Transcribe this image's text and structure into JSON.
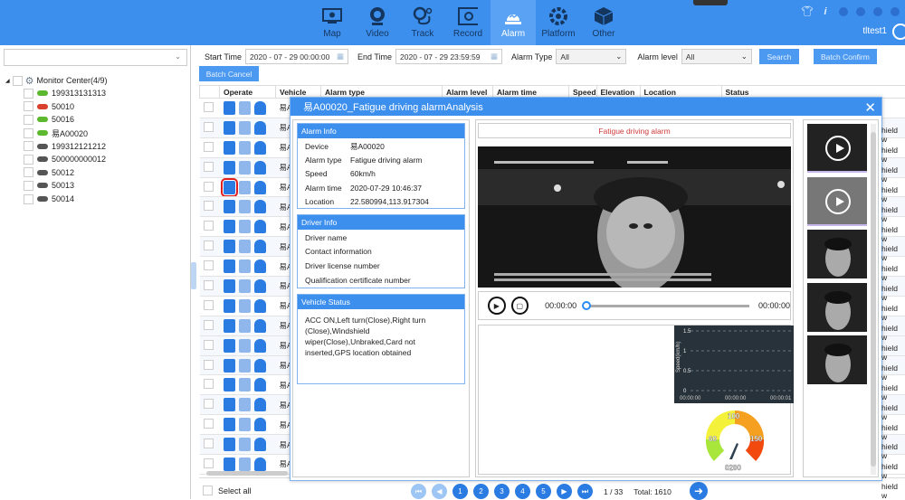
{
  "header": {
    "nav": [
      {
        "label": "Map",
        "icon": "monitor-eye-icon"
      },
      {
        "label": "Video",
        "icon": "webcam-icon"
      },
      {
        "label": "Track",
        "icon": "route-pin-icon"
      },
      {
        "label": "Record",
        "icon": "film-icon"
      },
      {
        "label": "Alarm",
        "icon": "alarm-light-icon",
        "active": true
      },
      {
        "label": "Platform",
        "icon": "gear-icon"
      },
      {
        "label": "Other",
        "icon": "cube-icon"
      }
    ],
    "username": "tltest1",
    "accent": "#3d8fee"
  },
  "sidebar": {
    "search_value": "",
    "root": "Monitor Center(4/9)",
    "vehicles": [
      {
        "id": "199313131313",
        "status": "online",
        "color": "#5cb82e"
      },
      {
        "id": "50010",
        "status": "alarm",
        "color": "#d9402b"
      },
      {
        "id": "50016",
        "status": "online",
        "color": "#5cb82e"
      },
      {
        "id": "易A00020",
        "status": "online",
        "color": "#5cb82e"
      },
      {
        "id": "199312121212",
        "status": "offline",
        "color": "#555555"
      },
      {
        "id": "500000000012",
        "status": "offline",
        "color": "#555555"
      },
      {
        "id": "50012",
        "status": "offline",
        "color": "#555555"
      },
      {
        "id": "50013",
        "status": "offline",
        "color": "#555555"
      },
      {
        "id": "50014",
        "status": "offline",
        "color": "#555555"
      }
    ]
  },
  "filters": {
    "start_label": "Start Time",
    "start_value": "2020 - 07 - 29 00:00:00",
    "end_label": "End Time",
    "end_value": "2020 - 07 - 29 23:59:59",
    "alarm_type_label": "Alarm Type",
    "alarm_type_value": "All",
    "alarm_level_label": "Alarm level",
    "alarm_level_value": "All",
    "search_btn": "Search",
    "batch_confirm_btn": "Batch Confirm",
    "batch_cancel_btn": "Batch Cancel"
  },
  "table": {
    "columns": [
      "",
      "Operate",
      "Vehicle",
      "Alarm type",
      "Alarm level",
      "Alarm time",
      "Speed",
      "Elevation",
      "Location",
      "Status"
    ],
    "row_vehicle": "易A",
    "row_status_tail": "hield w",
    "row_count": 19
  },
  "footer": {
    "select_all": "Select all",
    "pages": [
      "1",
      "2",
      "3",
      "4",
      "5"
    ],
    "page_info": "1  /  33",
    "total": "Total: 1610"
  },
  "modal": {
    "title": "易A00020_Fatigue driving alarmAnalysis",
    "alarm_info": {
      "title": "Alarm Info",
      "rows": [
        {
          "k": "Device",
          "v": "易A00020"
        },
        {
          "k": "Alarm type",
          "v": "Fatigue driving alarm"
        },
        {
          "k": "Speed",
          "v": "60km/h"
        },
        {
          "k": "Alarm time",
          "v": "2020-07-29 10:46:37"
        },
        {
          "k": "Location",
          "v": "22.580994,113.917304"
        }
      ]
    },
    "driver_info": {
      "title": "Driver Info",
      "rows": [
        "Driver name",
        "Contact information",
        "Driver license number",
        "Qualification certificate number"
      ]
    },
    "vehicle_status": {
      "title": "Vehicle Status",
      "text": "ACC ON,Left turn(Close),Right turn (Close),Windshield wiper(Close),Unbraked,Card not inserted,GPS location obtained"
    },
    "alarm_title": "Fatigue driving alarm",
    "player": {
      "current": "00:00:00",
      "duration": "00:00:00",
      "progress": 0
    },
    "speed_chart": {
      "ylabel": "Speed(km/h)",
      "yticks": [
        "1.5",
        "1",
        "0.5",
        "0"
      ],
      "xticks": [
        "00:00:00",
        "00:00:00",
        "00:00:01"
      ]
    },
    "gauge": {
      "labels": [
        "60",
        "100",
        "150"
      ],
      "value_label": "0200",
      "value": 0
    },
    "thumbnails": [
      {
        "type": "video"
      },
      {
        "type": "video"
      },
      {
        "type": "image"
      },
      {
        "type": "image"
      },
      {
        "type": "image"
      }
    ]
  }
}
